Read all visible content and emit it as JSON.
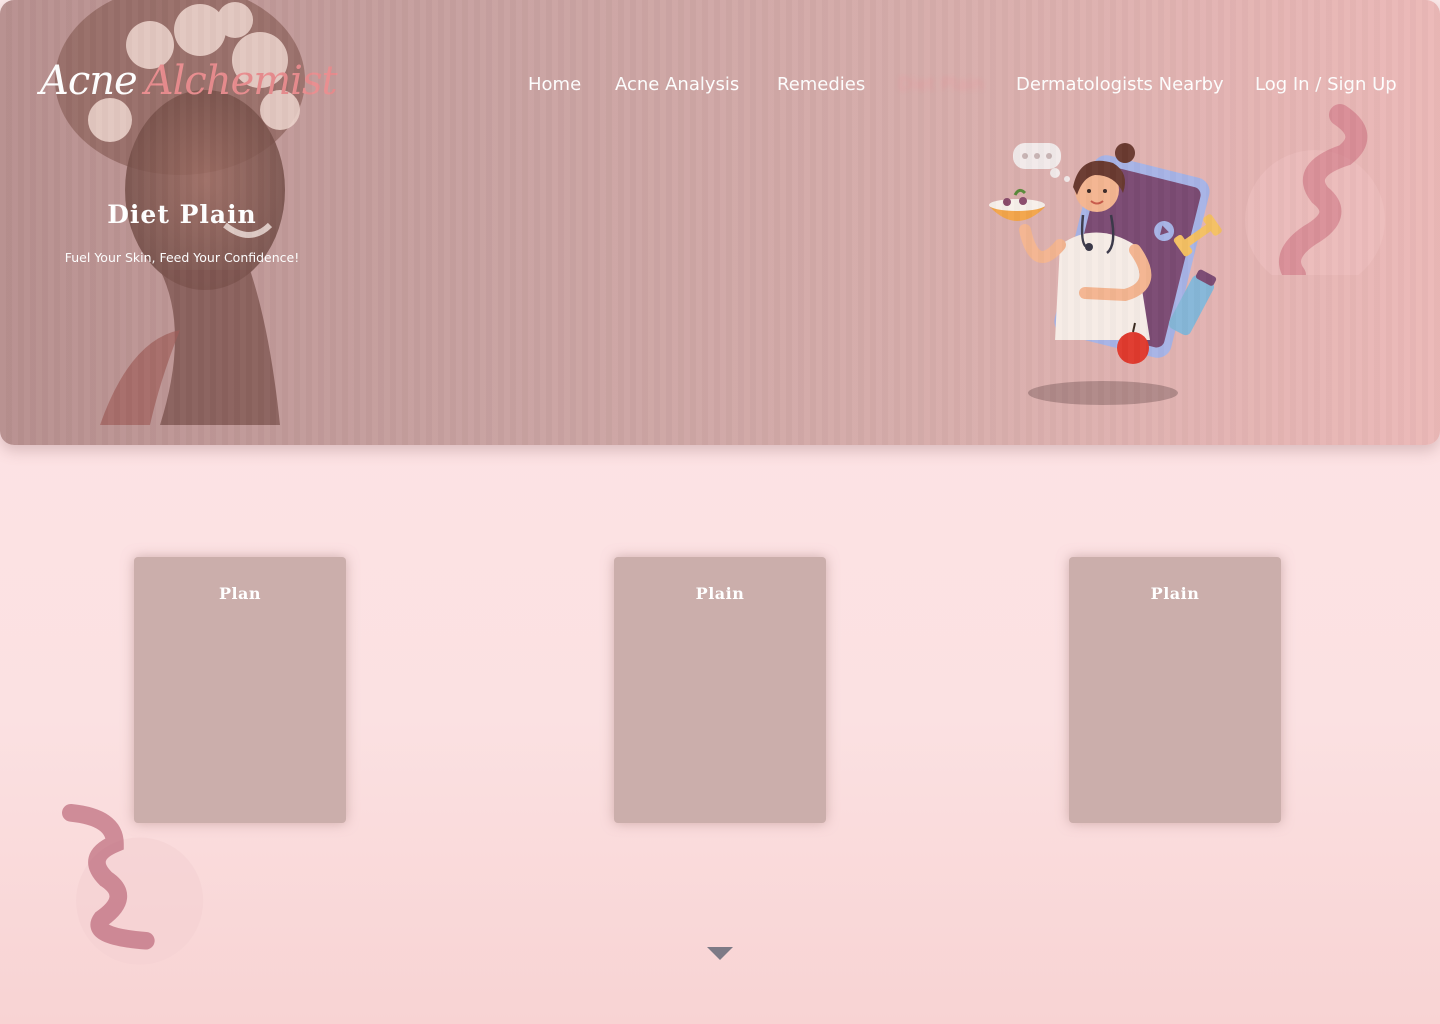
{
  "brand": {
    "logo_part1": "Acne",
    "logo_part2": "Alchemist"
  },
  "nav": {
    "items": [
      {
        "label": "Home"
      },
      {
        "label": "Acne Analysis"
      },
      {
        "label": "Remedies"
      },
      {
        "label": "Diet Plain",
        "active": true
      },
      {
        "label": "Dermatologists Nearby"
      },
      {
        "label": "Log In / Sign Up"
      }
    ]
  },
  "hero": {
    "title": "Diet Plain",
    "subtitle": "Fuel Your Skin, Feed Your Confidence!"
  },
  "cards": [
    {
      "title": "Plan"
    },
    {
      "title": "Plain"
    },
    {
      "title": "Plain"
    }
  ],
  "icons": {
    "scroll": "chevron-down-icon"
  },
  "colors": {
    "hero_start": "#b8908f",
    "hero_end": "#ecb9b8",
    "accent_pink": "#e98d8f",
    "card_bg": "#cbaeab",
    "page_bg": "#fde2e4",
    "arrow": "#7d7a86"
  }
}
